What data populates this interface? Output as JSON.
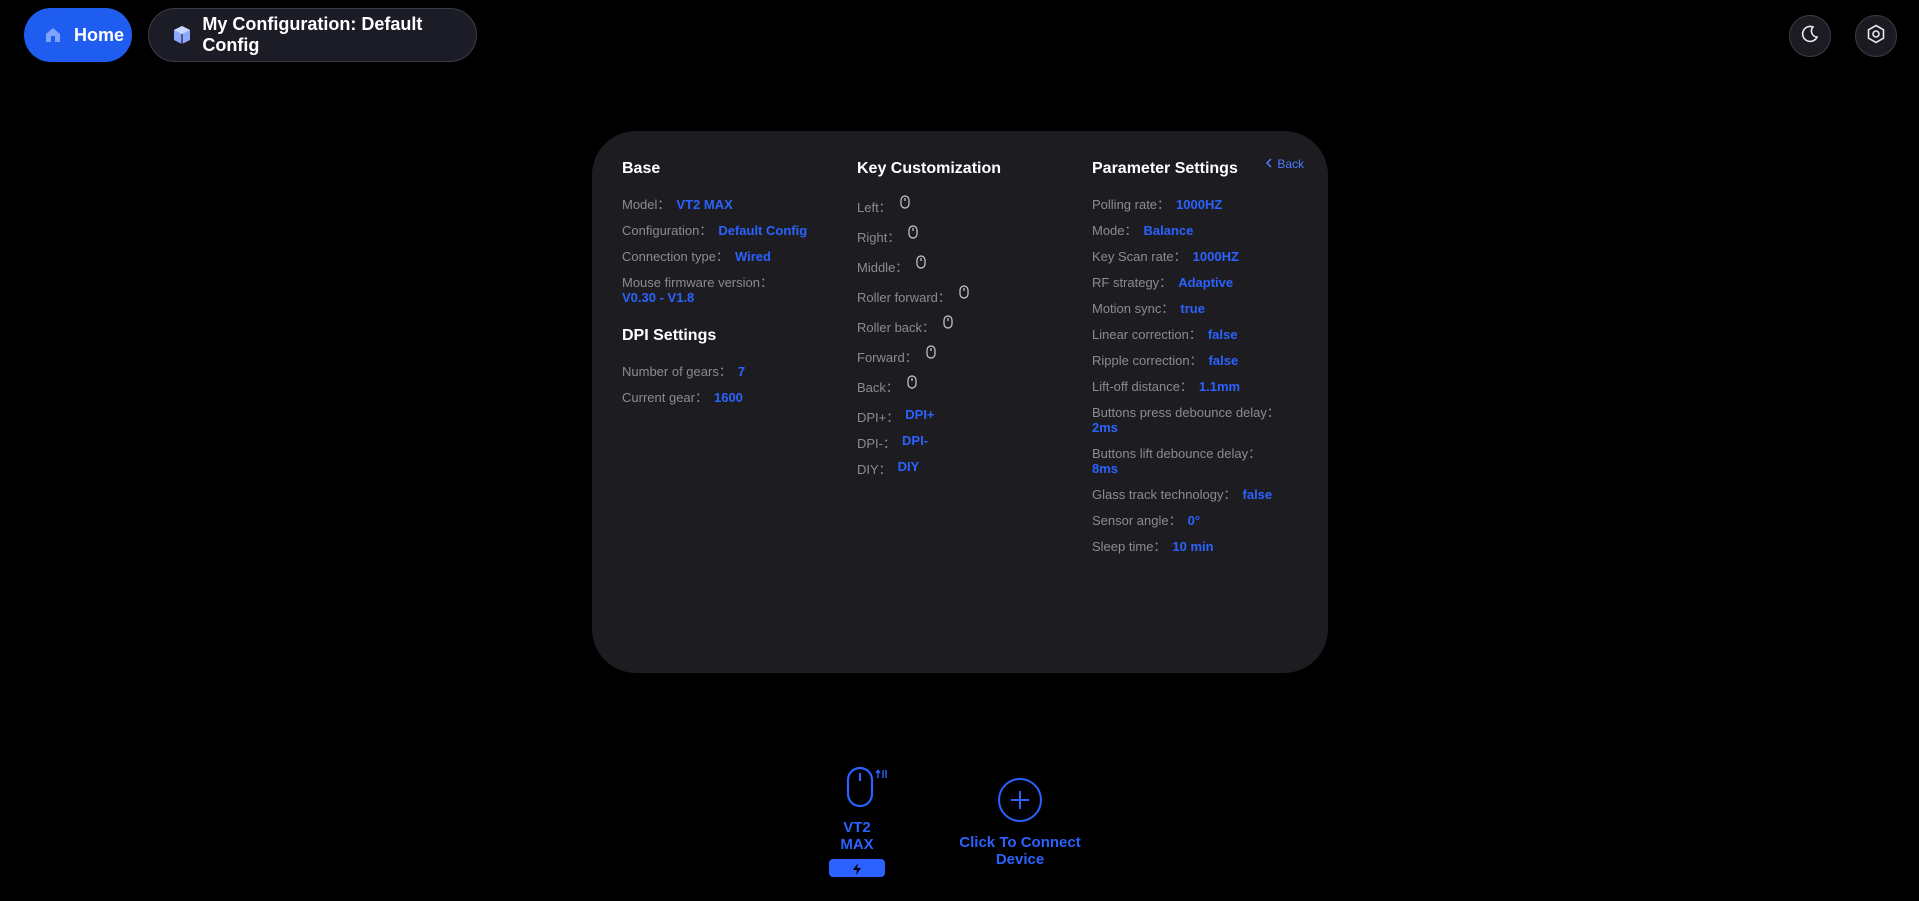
{
  "nav": {
    "home_label": "Home",
    "config_label": "My Configuration: Default Config"
  },
  "panel": {
    "back_label": "Back",
    "base": {
      "title": "Base",
      "model": {
        "label": "Model：",
        "value": "VT2 MAX"
      },
      "configuration": {
        "label": "Configuration：",
        "value": "Default Config"
      },
      "connection": {
        "label": "Connection type：",
        "value": "Wired"
      },
      "firmware": {
        "label": "Mouse firmware version：",
        "value": "V0.30 - V1.8"
      }
    },
    "dpi": {
      "title": "DPI Settings",
      "gears": {
        "label": "Number of gears：",
        "value": "7"
      },
      "current": {
        "label": "Current gear：",
        "value": "1600"
      }
    },
    "keys": {
      "title": "Key Customization",
      "left": "Left：",
      "right": "Right：",
      "middle": "Middle：",
      "roller_forward": "Roller forward：",
      "roller_back": "Roller back：",
      "forward": "Forward：",
      "back": "Back：",
      "dpi_plus": {
        "label": "DPI+：",
        "value": "DPI+"
      },
      "dpi_minus": {
        "label": "DPI-：",
        "value": "DPI-"
      },
      "diy": {
        "label": "DIY：",
        "value": "DIY"
      }
    },
    "params": {
      "title": "Parameter Settings",
      "polling": {
        "label": "Polling rate：",
        "value": "1000HZ"
      },
      "mode": {
        "label": "Mode：",
        "value": "Balance"
      },
      "keyscan": {
        "label": "Key Scan rate：",
        "value": "1000HZ"
      },
      "rf": {
        "label": "RF strategy：",
        "value": "Adaptive"
      },
      "motion": {
        "label": "Motion sync：",
        "value": "true"
      },
      "linear": {
        "label": "Linear correction：",
        "value": "false"
      },
      "ripple": {
        "label": "Ripple correction：",
        "value": "false"
      },
      "liftoff": {
        "label": "Lift-off distance：",
        "value": "1.1mm"
      },
      "press_debounce": {
        "label": "Buttons press debounce delay：",
        "value": "2ms"
      },
      "lift_debounce": {
        "label": "Buttons lift debounce delay：",
        "value": "8ms"
      },
      "glass": {
        "label": "Glass track technology：",
        "value": "false"
      },
      "sensor_angle": {
        "label": "Sensor angle：",
        "value": "0°"
      },
      "sleep": {
        "label": "Sleep time：",
        "value": "10 min"
      }
    }
  },
  "device": {
    "name": "VT2 MAX"
  },
  "connect": {
    "label": "Click To Connect Device"
  },
  "colors": {
    "accent": "#2b62ff",
    "panel": "#1d1d21",
    "background": "#000000"
  }
}
